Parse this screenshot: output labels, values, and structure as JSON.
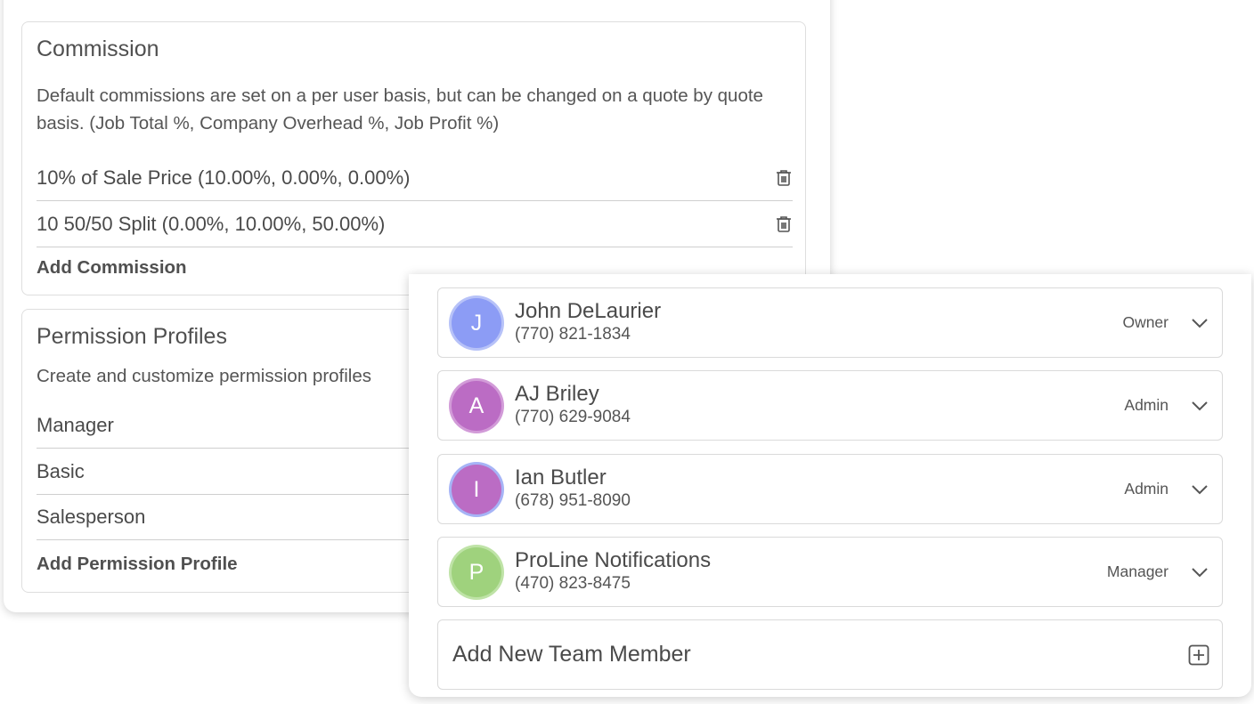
{
  "commission": {
    "title": "Commission",
    "description": "Default commissions are set on a per user basis, but can be changed on a quote by quote basis. (Job Total %, Company Overhead %, Job Profit %)",
    "items": [
      {
        "label": "10% of Sale Price (10.00%, 0.00%, 0.00%)",
        "icon": "trash-icon"
      },
      {
        "label": "10 50/50 Split (0.00%, 10.00%, 50.00%)",
        "icon": "trash-icon"
      }
    ],
    "add_label": "Add Commission"
  },
  "permissions": {
    "title": "Permission Profiles",
    "description": "Create and customize permission profiles",
    "items": [
      {
        "label": "Manager"
      },
      {
        "label": "Basic"
      },
      {
        "label": "Salesperson"
      }
    ],
    "add_label": "Add Permission Profile"
  },
  "team": {
    "members": [
      {
        "initial": "J",
        "name": "John DeLaurier",
        "phone": "(770) 821-1834",
        "role": "Owner",
        "color": "#8c9cf5",
        "ring": "#b7c2f8"
      },
      {
        "initial": "A",
        "name": "AJ Briley",
        "phone": "(770) 629-9084",
        "role": "Admin",
        "color": "#bb6cc4",
        "ring": "#d29bd8"
      },
      {
        "initial": "I",
        "name": "Ian Butler",
        "phone": "(678) 951-8090",
        "role": "Admin",
        "color": "#bb6cc4",
        "ring": "#a6b4f6"
      },
      {
        "initial": "P",
        "name": "ProLine Notifications",
        "phone": "(470) 823-8475",
        "role": "Manager",
        "color": "#9fd27d",
        "ring": "#bfe3a7"
      }
    ],
    "add_label": "Add New Team Member",
    "add_icon": "plus-square-icon",
    "chevron_icon": "chevron-down-icon"
  }
}
